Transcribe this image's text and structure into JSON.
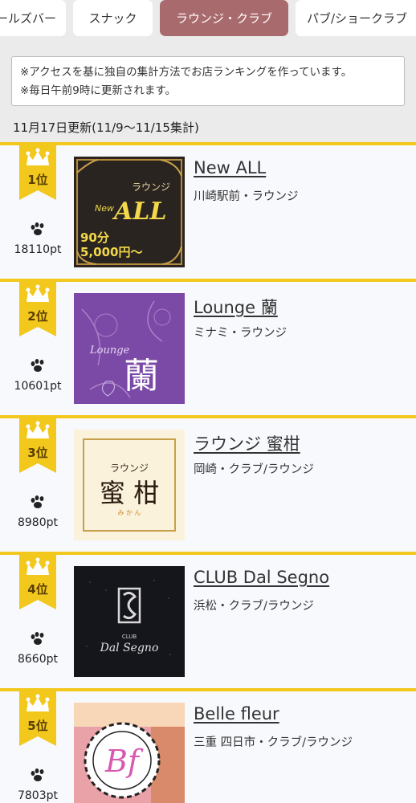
{
  "tabs": [
    {
      "label": "ールズバー",
      "active": false
    },
    {
      "label": "スナック",
      "active": false
    },
    {
      "label": "ラウンジ・クラブ",
      "active": true
    },
    {
      "label": "パブ/ショークラブ",
      "active": false
    }
  ],
  "notice": {
    "line1": "※アクセスを基に独自の集計方法でお店ランキングを作っています。",
    "line2": "※毎日午前9時に更新されます。"
  },
  "updated": "11月17日更新(11/9〜11/15集計)",
  "colors": {
    "accent": "#f2c81d",
    "active_tab": "#a96a6d",
    "row_bg": "#f8f9fd",
    "page_bg": "#ebebeb"
  },
  "ranking": [
    {
      "rank": "1位",
      "points": "18110pt",
      "name": "New ALL",
      "area": "川崎駅前・ラウンジ",
      "thumb": {
        "kana": "ラウンジ",
        "new": "New",
        "brand": "ALL",
        "price1": "90分",
        "price2": "5,000円〜"
      }
    },
    {
      "rank": "2位",
      "points": "10601pt",
      "name": "Lounge 蘭",
      "area": "ミナミ・ラウンジ",
      "thumb": {
        "script": "Lounge",
        "kanji": "蘭"
      }
    },
    {
      "rank": "3位",
      "points": "8980pt",
      "name": "ラウンジ 蜜柑",
      "area": "岡崎・クラブ/ラウンジ",
      "thumb": {
        "kana": "ラウンジ",
        "kanji": "蜜 柑",
        "ruby": "み か ん"
      }
    },
    {
      "rank": "4位",
      "points": "8660pt",
      "name": "CLUB Dal Segno",
      "area": "浜松・クラブ/ラウンジ",
      "thumb": {
        "club": "CLUB",
        "script": "Dal Segno"
      }
    },
    {
      "rank": "5位",
      "points": "7803pt",
      "name": "Belle fleur",
      "area": "三重 四日市・クラブ/ラウンジ",
      "thumb": {
        "mono": "Bf"
      }
    }
  ]
}
